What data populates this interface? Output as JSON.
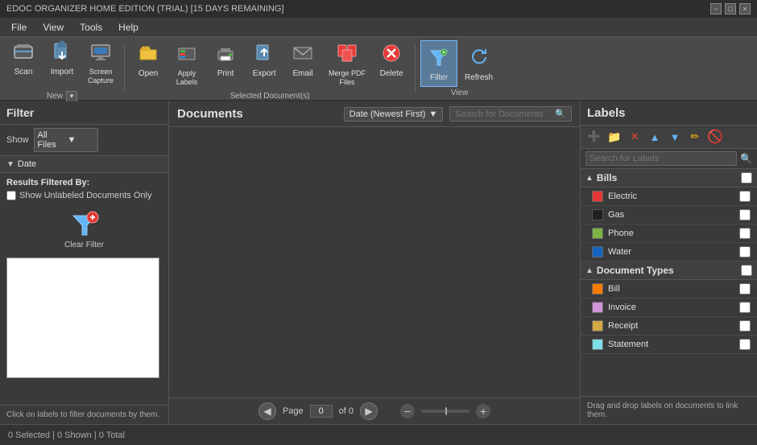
{
  "titleBar": {
    "title": "EDOC ORGANIZER HOME EDITION (TRIAL) [15 DAYS REMAINING]",
    "controls": {
      "minimize": "−",
      "maximize": "□",
      "close": "×"
    }
  },
  "menuBar": {
    "items": [
      "File",
      "View",
      "Tools",
      "Help"
    ]
  },
  "toolbar": {
    "groups": [
      {
        "label": "New",
        "buttons": [
          {
            "id": "scan",
            "label": "Scan",
            "icon": "scan"
          },
          {
            "id": "import",
            "label": "Import",
            "icon": "import"
          },
          {
            "id": "screen-capture",
            "label": "Screen\nCapture",
            "icon": "screenshot"
          }
        ]
      },
      {
        "label": "Selected Document(s)",
        "buttons": [
          {
            "id": "open",
            "label": "Open",
            "icon": "open"
          },
          {
            "id": "apply-labels",
            "label": "Apply\nLabels",
            "icon": "labels"
          },
          {
            "id": "print",
            "label": "Print",
            "icon": "print"
          },
          {
            "id": "export",
            "label": "Export",
            "icon": "export"
          },
          {
            "id": "email",
            "label": "Email",
            "icon": "email"
          },
          {
            "id": "merge-pdf",
            "label": "Merge PDF\nFiles",
            "icon": "merge"
          },
          {
            "id": "delete",
            "label": "Delete",
            "icon": "delete"
          }
        ]
      },
      {
        "label": "View",
        "buttons": [
          {
            "id": "filter",
            "label": "Filter",
            "icon": "filter",
            "active": true
          },
          {
            "id": "refresh",
            "label": "Refresh",
            "icon": "refresh"
          }
        ]
      }
    ]
  },
  "filterPanel": {
    "title": "Filter",
    "showLabel": "Show",
    "showValue": "All Files",
    "dateLabel": "Date",
    "resultsLabel": "Results Filtered By:",
    "showUnlabeled": "Show Unlabeled Documents Only",
    "clearFilterLabel": "Clear Filter",
    "footerText": "Click on labels to filter documents by them."
  },
  "documentsPanel": {
    "title": "Documents",
    "sortLabel": "Date (Newest First)",
    "searchPlaceholder": "Search for Documents",
    "pageLabel": "Page",
    "pageValue": "0",
    "pageOf": "of 0"
  },
  "labelsPanel": {
    "title": "Labels",
    "searchPlaceholder": "Search for Labels",
    "groups": [
      {
        "name": "Bills",
        "expanded": true,
        "items": [
          {
            "name": "Electric",
            "color": "#e53935"
          },
          {
            "name": "Gas",
            "color": "#212121"
          },
          {
            "name": "Phone",
            "color": "#7cb342"
          },
          {
            "name": "Water",
            "color": "#1565c0"
          }
        ]
      },
      {
        "name": "Document Types",
        "expanded": true,
        "items": [
          {
            "name": "Bill",
            "color": "#f57c00"
          },
          {
            "name": "Invoice",
            "color": "#ce93d8"
          },
          {
            "name": "Receipt",
            "color": "#d4a843"
          },
          {
            "name": "Statement",
            "color": "#80deea"
          }
        ]
      }
    ],
    "footerText": "Drag and drop labels on documents to link them."
  },
  "statusBar": {
    "text": "0 Selected | 0 Shown | 0 Total"
  }
}
